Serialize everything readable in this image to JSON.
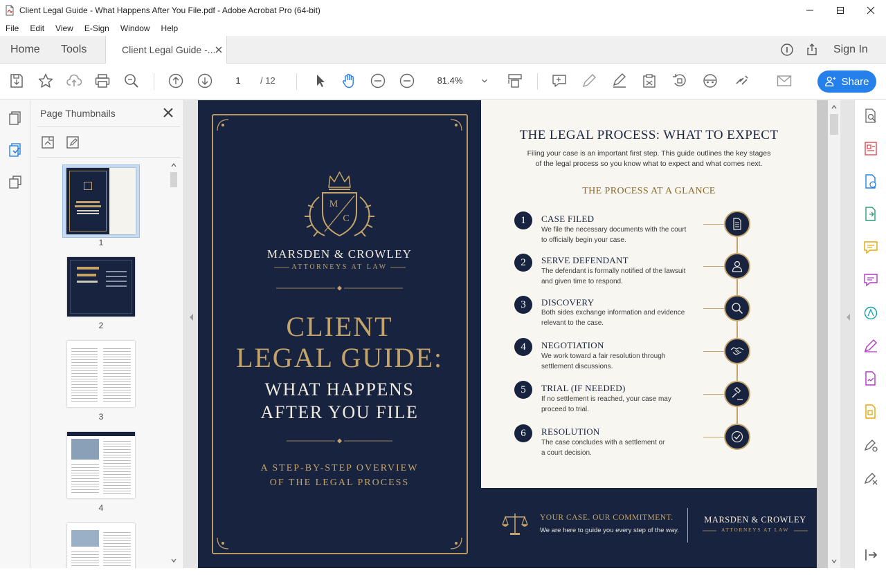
{
  "window": {
    "title": "Client Legal Guide - What Happens After You File.pdf - Adobe Acrobat Pro (64-bit)"
  },
  "menu": [
    "File",
    "Edit",
    "View",
    "E-Sign",
    "Window",
    "Help"
  ],
  "tabs": {
    "home": "Home",
    "tools": "Tools",
    "document": "Client Legal Guide -...",
    "sign_in": "Sign In"
  },
  "toolbar": {
    "current_page": "1",
    "page_total": "/ 12",
    "zoom": "81.4%",
    "share_label": "Share"
  },
  "thumbnails": {
    "title": "Page Thumbnails",
    "pages": [
      "1",
      "2",
      "3",
      "4"
    ]
  },
  "cover": {
    "monogram_left": "M",
    "monogram_right": "C",
    "firm": "MARSDEN & CROWLEY",
    "firm_sub": "ATTORNEYS AT LAW",
    "title_line1": "CLIENT",
    "title_line2": "LEGAL GUIDE:",
    "title_line3": "WHAT HAPPENS",
    "title_line4": "AFTER YOU FILE",
    "overview_line1": "A STEP-BY-STEP OVERVIEW",
    "overview_line2": "OF THE LEGAL PROCESS"
  },
  "inner": {
    "heading": "THE LEGAL PROCESS: WHAT TO EXPECT",
    "intro_line1": "Filing your case is an important first step. This guide outlines the key stages",
    "intro_line2": "of the legal process so you know what to expect and what comes next.",
    "subheading": "THE PROCESS AT A GLANCE",
    "steps": [
      {
        "num": "1",
        "title": "CASE FILED",
        "desc1": "We file the necessary documents with the court",
        "desc2": "to officially begin your case.",
        "icon": "document-icon"
      },
      {
        "num": "2",
        "title": "SERVE DEFENDANT",
        "desc1": "The defendant is formally notified of the lawsuit",
        "desc2": "and given time to respond.",
        "icon": "person-icon"
      },
      {
        "num": "3",
        "title": "DISCOVERY",
        "desc1": "Both sides exchange information and evidence",
        "desc2": "relevant to the case.",
        "icon": "magnifier-icon"
      },
      {
        "num": "4",
        "title": "NEGOTIATION",
        "desc1": "We work toward a fair resolution through",
        "desc2": "settlement discussions.",
        "icon": "handshake-icon"
      },
      {
        "num": "5",
        "title": "TRIAL (IF NEEDED)",
        "desc1": "If no settlement is reached, your case may",
        "desc2": "proceed to trial.",
        "icon": "gavel-icon"
      },
      {
        "num": "6",
        "title": "RESOLUTION",
        "desc1": "The case concludes with a settlement or",
        "desc2": "a court decision.",
        "icon": "checkmark-icon"
      }
    ]
  },
  "footer_band": {
    "tagline": "YOUR CASE. OUR COMMITMENT.",
    "subline": "We are here to guide you every step of the way.",
    "firm": "MARSDEN & CROWLEY",
    "firm_sub": "ATTORNEYS AT LAW"
  },
  "colors": {
    "navy": "#17233f",
    "gold": "#c4a46b",
    "accent_blue": "#2680eb"
  }
}
